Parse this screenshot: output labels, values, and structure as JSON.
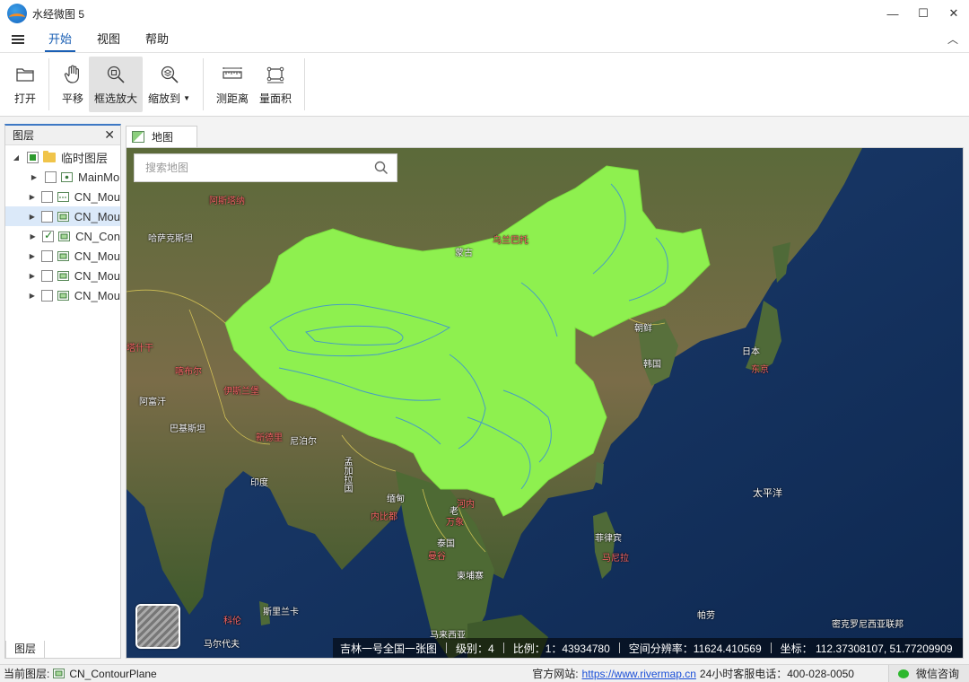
{
  "window": {
    "title": "水经微图 5",
    "min": "—",
    "max": "☐",
    "close": "✕"
  },
  "menu": {
    "tabs": [
      "开始",
      "视图",
      "帮助"
    ],
    "active": 0,
    "collapse": "︿"
  },
  "ribbon": {
    "open": "打开",
    "pan": "平移",
    "box_zoom": "框选放大",
    "zoom_to": "缩放到",
    "measure_distance": "测距离",
    "measure_area": "量面积"
  },
  "layers_panel": {
    "title": "图层",
    "root": "临时图层",
    "items": [
      {
        "label": "MainMo",
        "checked": false
      },
      {
        "label": "CN_Mou",
        "checked": false
      },
      {
        "label": "CN_Mou",
        "checked": false
      },
      {
        "label": "CN_Con",
        "checked": true
      },
      {
        "label": "CN_Mou",
        "checked": false
      },
      {
        "label": "CN_Mou",
        "checked": false
      },
      {
        "label": "CN_Mou",
        "checked": false
      }
    ],
    "bottom_tab": "图层"
  },
  "map_tab": {
    "label": "地图"
  },
  "search": {
    "placeholder": "搜索地图"
  },
  "map_status": {
    "source": "吉林一号全国一张图",
    "level": "级别：4",
    "scale": "比例：1：43934780",
    "resolution": "空间分辨率：11624.410569",
    "coords": "坐标：  112.37308107,  51.77209909"
  },
  "map_labels": {
    "kazakhstan": "哈萨克斯坦",
    "mongolia": "蒙古",
    "ulaanbaatar": "乌兰巴托",
    "n_korea": "朝鲜",
    "s_korea": "韩国",
    "japan": "日本",
    "tokyo": "东京",
    "afghanistan": "阿富汗",
    "pakistan": "巴基斯坦",
    "islamabad": "伊斯兰堡",
    "india": "印度",
    "new_delhi": "新德里",
    "nepal": "尼泊尔",
    "bangladesh": "孟加拉国",
    "myanmar": "缅甸",
    "naypyidaw": "内比都",
    "hanoi": "河内",
    "vientiane": "万象",
    "thailand": "泰国",
    "bangkok": "曼谷",
    "cambodia": "柬埔寨",
    "philippines": "菲律宾",
    "manila": "马尼拉",
    "pacific": "太平洋",
    "sri_lanka": "斯里兰卡",
    "malaysia": "马来西亚",
    "palau": "帕劳",
    "micronesia": "密克罗尼西亚联邦",
    "maldives": "马尔代夫",
    "colombo": "科伦",
    "astana": "阿斯塔纳",
    "tashkent": "塔什干",
    "kabul": "喀布尔",
    "laos": "老"
  },
  "statusbar": {
    "current_layer_label": "当前图层:",
    "current_layer": "CN_ContourPlane",
    "website_label": "官方网站:",
    "website": "https://www.rivermap.cn",
    "hotline": "24小时客服电话：400-028-0050",
    "wechat": "微信咨询"
  },
  "colors": {
    "accent": "#1a5fb4",
    "china_fill": "#8ef04f",
    "contour": "#3a8fd8",
    "ocean": "#14325e"
  }
}
